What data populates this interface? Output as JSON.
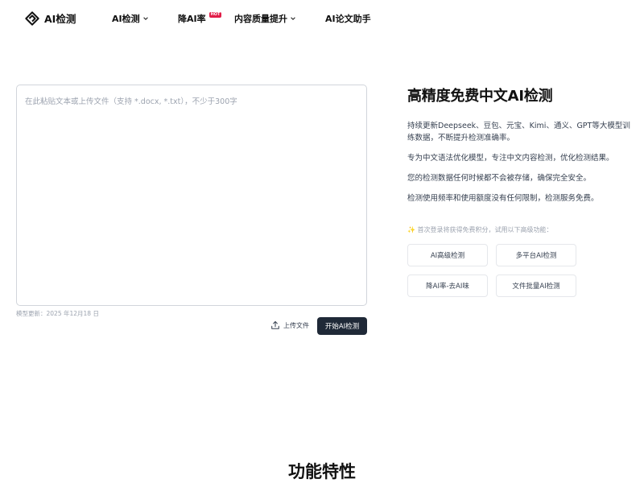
{
  "header": {
    "logo_text": "AI检测",
    "nav": [
      {
        "label": "AI检测",
        "has_dropdown": true
      },
      {
        "label": "降AI率",
        "badge": "HOT"
      },
      {
        "label": "内容质量提升",
        "has_dropdown": true
      },
      {
        "label": "AI论文助手"
      }
    ]
  },
  "editor": {
    "placeholder": "在此粘贴文本或上传文件（支持 *.docx, *.txt），不少于300字",
    "model_update": "模型更新：2025 年12月18 日",
    "upload_label": "上传文件",
    "start_label": "开始AI检测"
  },
  "info": {
    "title": "高精度免费中文AI检测",
    "lines": [
      "持续更新Deepseek、豆包、元宝、Kimi、通义、GPT等大模型训练数据，不断提升检测准确率。",
      "专为中文语法优化模型，专注中文内容检测，优化检测结果。",
      "您的检测数据任何时候都不会被存储，确保完全安全。",
      "检测使用频率和使用额度没有任何限制，检测服务免费。"
    ],
    "promo": "✨ 首次登录将获得免费积分，试用以下高级功能：",
    "advanced": [
      "AI高级检测",
      "多平台AI检测",
      "降AI率-去AI味",
      "文件批量AI检测"
    ]
  },
  "section": {
    "title": "功能特性"
  },
  "colors": {
    "primary_button": "#1f2937",
    "hot_badge": "#e11d48"
  }
}
